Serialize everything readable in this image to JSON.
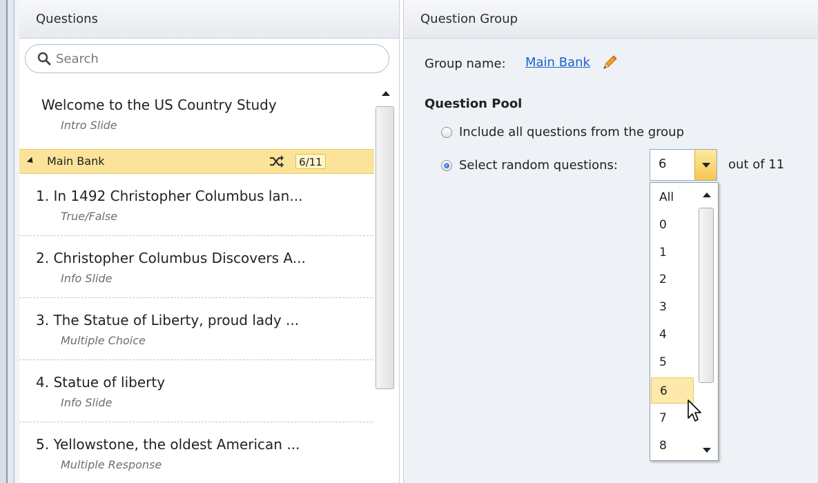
{
  "questions_panel": {
    "title": "Questions",
    "search": {
      "placeholder": "Search",
      "value": ""
    },
    "intro": {
      "title": "Welcome to the US Country Study",
      "type": "Intro Slide"
    },
    "group": {
      "name": "Main Bank",
      "count": "6/11",
      "expanded": true
    },
    "items": [
      {
        "title": "1. In 1492 Christopher Columbus lan...",
        "type": "True/False"
      },
      {
        "title": "2. Christopher Columbus Discovers A...",
        "type": "Info Slide"
      },
      {
        "title": "3. The Statue of Liberty, proud lady ...",
        "type": "Multiple Choice"
      },
      {
        "title": "4. Statue of liberty",
        "type": "Info Slide"
      },
      {
        "title": "5. Yellowstone, the oldest American ...",
        "type": "Multiple Response"
      }
    ]
  },
  "group_panel": {
    "title": "Question Group",
    "group_name_label": "Group name:",
    "group_name": "Main Bank",
    "pool_heading": "Question Pool",
    "option_all": "Include all questions from the group",
    "option_random": "Select random questions:",
    "selected_option": "random",
    "random_count": "6",
    "out_of": "out of 11",
    "dropdown_options": [
      "All",
      "0",
      "1",
      "2",
      "3",
      "4",
      "5",
      "6",
      "7",
      "8"
    ],
    "hovered_option": "6"
  },
  "colors": {
    "group_highlight": "#fbe39a",
    "link": "#1a5fd0",
    "panel_bg": "#eef1f5"
  },
  "icons": [
    "search-icon",
    "shuffle-icon",
    "pencil-icon",
    "mouse-cursor-icon"
  ]
}
